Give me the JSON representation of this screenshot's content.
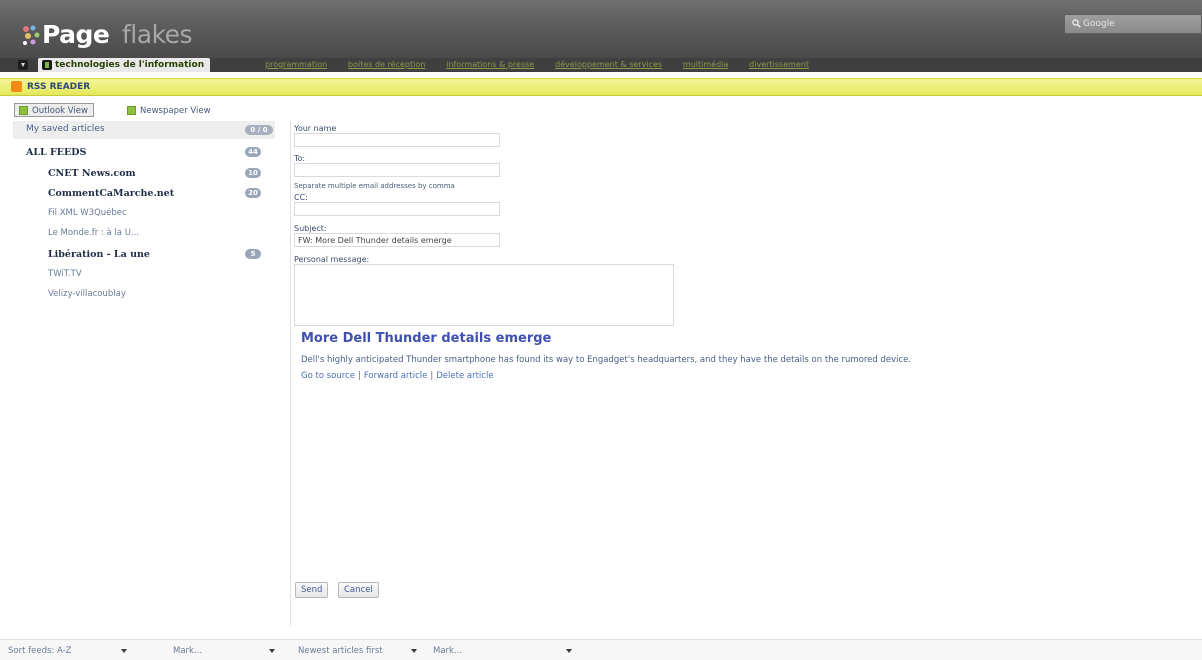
{
  "app": {
    "logo_main": "Page",
    "logo_sub": "flakes",
    "search_placeholder": "Google"
  },
  "tabs": {
    "active_label": "technologies de l'information",
    "others": [
      "programmation",
      "boites de réception",
      "informations & presse",
      "développement & services",
      "multimédia",
      "divertissement"
    ]
  },
  "rss": {
    "title": "RSS READER"
  },
  "views": {
    "outlook": "Outlook View",
    "newspaper": "Newspaper View"
  },
  "sidebar": {
    "saved": {
      "label": "My saved articles",
      "count": "0 / 0"
    },
    "feeds": [
      {
        "label": "ALL FEEDS",
        "count": "44",
        "style": "bold"
      },
      {
        "label": "CNET News.com",
        "count": "10",
        "style": "bold"
      },
      {
        "label": "CommentCaMarche.net",
        "count": "20",
        "style": "bold"
      },
      {
        "label": "Fil XML W3Québec",
        "count": "",
        "style": "light"
      },
      {
        "label": "Le Monde.fr : à la U...",
        "count": "",
        "style": "light"
      },
      {
        "label": "Libération - La une",
        "count": "5",
        "style": "bold"
      },
      {
        "label": "TWiT.TV",
        "count": "",
        "style": "light"
      },
      {
        "label": "Velizy-villacoublay",
        "count": "",
        "style": "light"
      }
    ]
  },
  "form": {
    "name_label": "Your name",
    "name_value": "",
    "to_label": "To:",
    "to_value": "",
    "note": "Separate multiple email addresses by comma",
    "cc_label": "CC:",
    "cc_value": "",
    "subject_label": "Subject:",
    "subject_value": "FW: More Dell Thunder details emerge",
    "message_label": "Personal message:",
    "send": "Send",
    "cancel": "Cancel"
  },
  "article": {
    "title": "More Dell Thunder details emerge",
    "snippet": "Dell's highly anticipated Thunder smartphone has found its way to Engadget's headquarters, and they have the details on the rumored device.",
    "link_source": "Go to source",
    "link_forward": "Forward article",
    "link_delete": "Delete article",
    "sep": "|"
  },
  "bottom": {
    "sort": "Sort feeds: A-Z",
    "mark_left": "Mark...",
    "order": "Newest articles first",
    "mark_right": "Mark..."
  }
}
